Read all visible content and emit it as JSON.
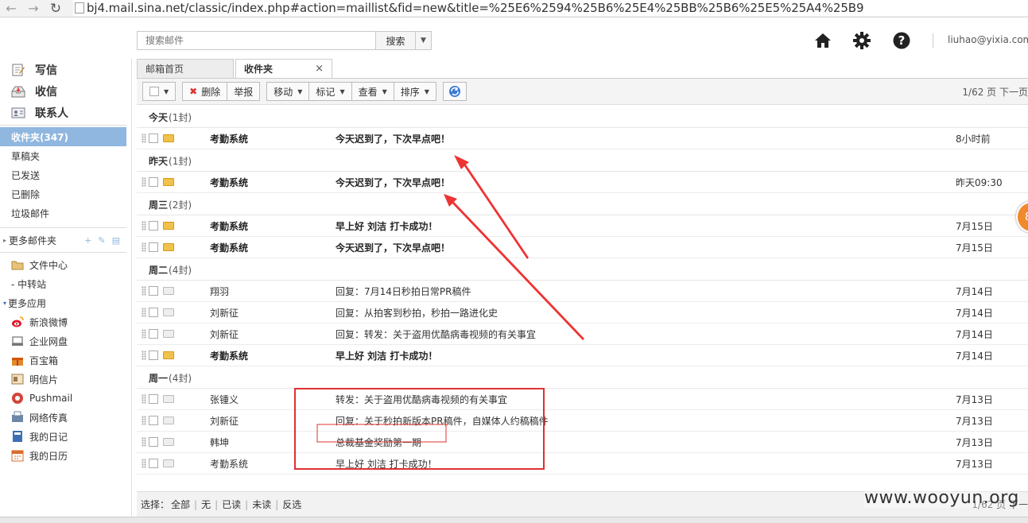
{
  "browser": {
    "url": "bj4.mail.sina.net/classic/index.php#action=maillist&fid=new&title=%25E6%2594%25B6%25E4%25BB%25B6%25E5%25A4%25B9"
  },
  "header": {
    "search_placeholder": "搜索邮件",
    "search_button": "搜索",
    "user_email": "liuhao@yixia.com"
  },
  "sidebar": {
    "actions": [
      {
        "label": "写信",
        "icon": "compose-icon"
      },
      {
        "label": "收信",
        "icon": "inbox-tray-icon"
      },
      {
        "label": "联系人",
        "icon": "contacts-icon"
      }
    ],
    "folders": [
      {
        "label": "收件夹(347)",
        "active": true
      },
      {
        "label": "草稿夹"
      },
      {
        "label": "已发送"
      },
      {
        "label": "已删除"
      },
      {
        "label": "垃圾邮件"
      }
    ],
    "more_folders": "更多邮件夹",
    "file_center": "文件中心",
    "transfer_station": "- 中转站",
    "more_apps": "更多应用",
    "apps": [
      {
        "label": "新浪微博",
        "icon": "weibo-icon",
        "color": "#e6162d"
      },
      {
        "label": "企业网盘",
        "icon": "disk-icon",
        "color": "#7a8aa0"
      },
      {
        "label": "百宝箱",
        "icon": "gift-icon",
        "color": "#e08a2c"
      },
      {
        "label": "明信片",
        "icon": "postcard-icon",
        "color": "#b98a4a"
      },
      {
        "label": "Pushmail",
        "icon": "pushmail-icon",
        "color": "#d2453a"
      },
      {
        "label": "网络传真",
        "icon": "fax-icon",
        "color": "#6d87a8"
      },
      {
        "label": "我的日记",
        "icon": "diary-icon",
        "color": "#3d6fb6"
      },
      {
        "label": "我的日历",
        "icon": "calendar-icon",
        "color": "#d96b2b"
      }
    ]
  },
  "tabs": [
    {
      "label": "邮箱首页",
      "active": false
    },
    {
      "label": "收件夹",
      "active": true,
      "close": "×"
    }
  ],
  "toolbar": {
    "delete": "删除",
    "report": "举报",
    "move": "移动",
    "mark": "标记",
    "view": "查看",
    "sort": "排序",
    "pager": "1/62 页  下一页"
  },
  "groups": [
    {
      "title": "今天",
      "count": "(1封)",
      "mails": [
        {
          "sender": "考勤系统",
          "subject": "今天迟到了，下次早点吧！",
          "date": "8小时前",
          "unread": true
        }
      ]
    },
    {
      "title": "昨天",
      "count": "(1封)",
      "mails": [
        {
          "sender": "考勤系统",
          "subject": "今天迟到了，下次早点吧！",
          "date": "昨天09:30",
          "unread": true
        }
      ]
    },
    {
      "title": "周三",
      "count": "(2封)",
      "mails": [
        {
          "sender": "考勤系统",
          "subject": "早上好 刘洁 打卡成功！",
          "date": "7月15日",
          "unread": true
        },
        {
          "sender": "考勤系统",
          "subject": "今天迟到了，下次早点吧！",
          "date": "7月15日",
          "unread": true
        }
      ]
    },
    {
      "title": "周二",
      "count": "(4封)",
      "mails": [
        {
          "sender": "翔羽",
          "subject": "回复：7月14日秒拍日常PR稿件",
          "date": "7月14日",
          "unread": false
        },
        {
          "sender": "刘新征",
          "subject": "回复：从拍客到秒拍，秒拍一路进化史",
          "date": "7月14日",
          "unread": false
        },
        {
          "sender": "刘新征",
          "subject": "回复：转发：关于盗用优酷病毒视频的有关事宜",
          "date": "7月14日",
          "unread": false
        },
        {
          "sender": "考勤系统",
          "subject": "早上好 刘洁 打卡成功！",
          "date": "7月14日",
          "unread": true
        }
      ]
    },
    {
      "title": "周一",
      "count": "(4封)",
      "mails": [
        {
          "sender": "张锺义",
          "subject": "转发：关于盗用优酷病毒视频的有关事宜",
          "date": "7月13日",
          "unread": false
        },
        {
          "sender": "刘新征",
          "subject": "回复：关于秒拍新版本PR稿件，自媒体人约稿稿件",
          "date": "7月13日",
          "unread": false
        },
        {
          "sender": "韩坤",
          "subject": "总裁基金奖励第一期",
          "date": "7月13日",
          "unread": false
        },
        {
          "sender": "考勤系统",
          "subject": "早上好 刘洁 打卡成功！",
          "date": "7月13日",
          "unread": false
        }
      ]
    }
  ],
  "bottombar": {
    "select_label": "选择：",
    "options": [
      "全部",
      "无",
      "已读",
      "未读",
      "反选"
    ],
    "pager": "1/62 页  下一"
  },
  "float_badge": "8",
  "watermark": "www.wooyun.org",
  "annotation_colors": {
    "arrow": "#ee3333",
    "box": "#e03030"
  }
}
